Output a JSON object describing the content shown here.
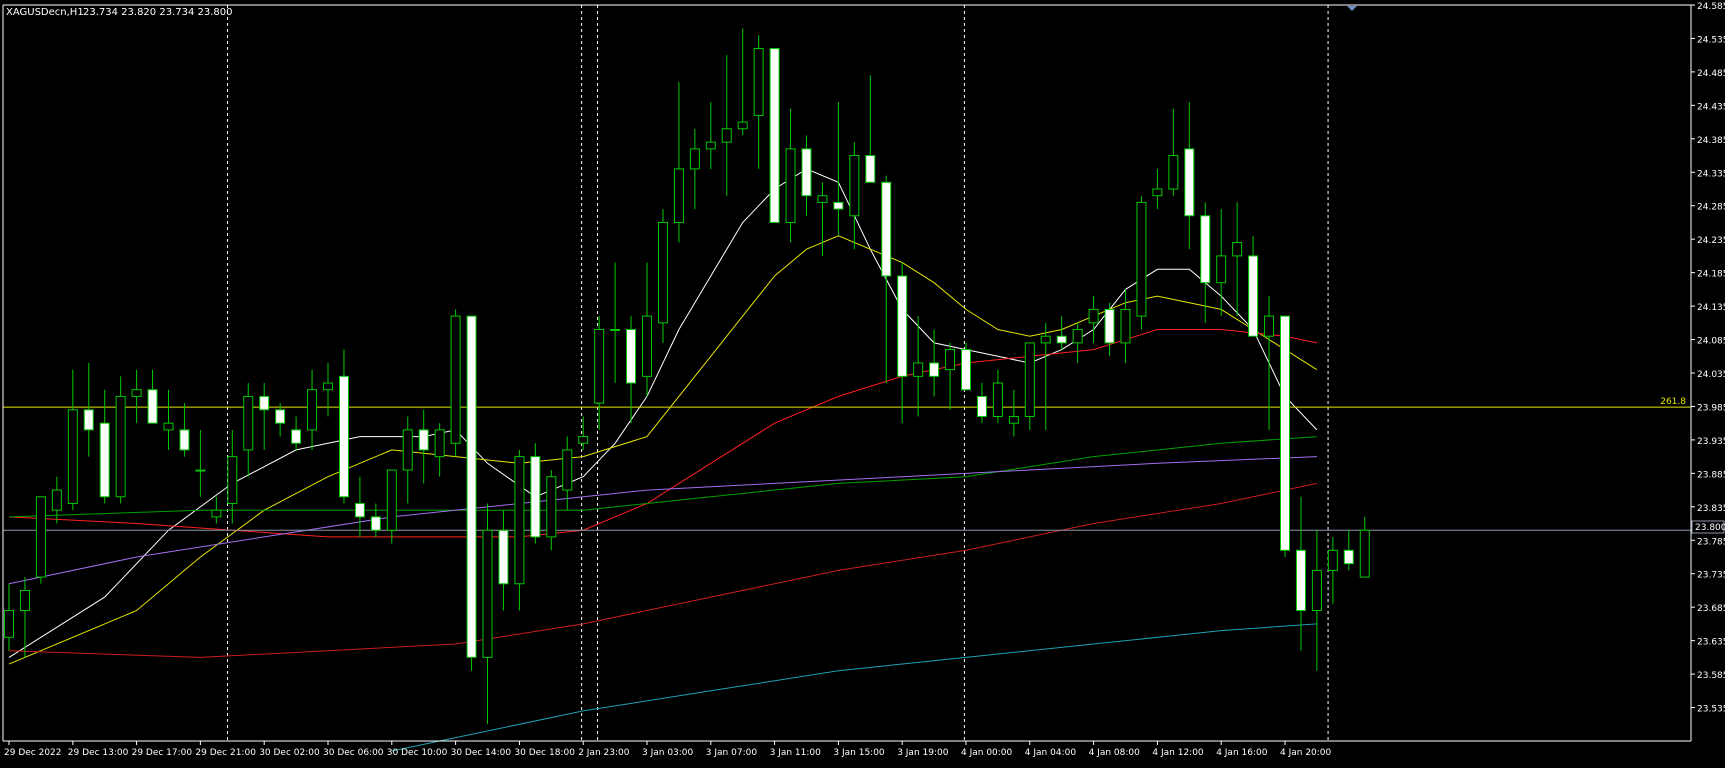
{
  "header": {
    "symbol_label": "XAGUSDecn,H1",
    "ohlc_label": "23.734 23.820 23.734 23.800"
  },
  "colors": {
    "background": "#000000",
    "frame": "#FFFFFF",
    "axis_text": "#FFFFFF",
    "candle_outline": "#00C800",
    "bull_fill": "#000000",
    "bear_fill": "#FFFFFF",
    "day_separator": "#FFFFFF",
    "fib_line": "#E6E600",
    "price_line": "#8C96A8",
    "price_label_bg": "#000000",
    "period_marker": "#6E8CBE"
  },
  "fib_level": {
    "label": "261.8",
    "price": 23.984
  },
  "current_price": {
    "label": "23.800",
    "price": 23.8
  },
  "chart_data": {
    "type": "candlestick",
    "timeframe": "H1",
    "symbol": "XAGUSDecn",
    "ylim": [
      23.485,
      24.585
    ],
    "y_ticks": [
      "23.535",
      "23.585",
      "23.635",
      "23.685",
      "23.735",
      "23.785",
      "23.835",
      "23.885",
      "23.935",
      "23.985",
      "24.035",
      "24.085",
      "24.135",
      "24.185",
      "24.235",
      "24.285",
      "24.335",
      "24.385",
      "24.435",
      "24.485",
      "24.535",
      "24.585"
    ],
    "x_labels": [
      {
        "label": "29 Dec 2022",
        "bar": 0
      },
      {
        "label": "29 Dec 13:00",
        "bar": 4
      },
      {
        "label": "29 Dec 17:00",
        "bar": 8
      },
      {
        "label": "29 Dec 21:00",
        "bar": 12
      },
      {
        "label": "30 Dec 02:00",
        "bar": 16
      },
      {
        "label": "30 Dec 06:00",
        "bar": 20
      },
      {
        "label": "30 Dec 10:00",
        "bar": 24
      },
      {
        "label": "30 Dec 14:00",
        "bar": 28
      },
      {
        "label": "30 Dec 18:00",
        "bar": 32
      },
      {
        "label": "2 Jan 23:00",
        "bar": 36
      },
      {
        "label": "3 Jan 03:00",
        "bar": 40
      },
      {
        "label": "3 Jan 07:00",
        "bar": 44
      },
      {
        "label": "3 Jan 11:00",
        "bar": 48
      },
      {
        "label": "3 Jan 15:00",
        "bar": 52
      },
      {
        "label": "3 Jan 19:00",
        "bar": 56
      },
      {
        "label": "4 Jan 00:00",
        "bar": 60
      },
      {
        "label": "4 Jan 04:00",
        "bar": 64
      },
      {
        "label": "4 Jan 08:00",
        "bar": 68
      },
      {
        "label": "4 Jan 12:00",
        "bar": 72
      },
      {
        "label": "4 Jan 16:00",
        "bar": 76
      },
      {
        "label": "4 Jan 20:00",
        "bar": 80
      }
    ],
    "separator_bars": [
      13.7,
      35.9,
      36.9,
      59.9,
      82.7
    ],
    "candles": [
      {
        "o": 23.64,
        "h": 23.72,
        "l": 23.62,
        "c": 23.68
      },
      {
        "o": 23.68,
        "h": 23.73,
        "l": 23.61,
        "c": 23.71
      },
      {
        "o": 23.73,
        "h": 23.85,
        "l": 23.72,
        "c": 23.85
      },
      {
        "o": 23.83,
        "h": 23.88,
        "l": 23.81,
        "c": 23.86
      },
      {
        "o": 23.84,
        "h": 24.04,
        "l": 23.83,
        "c": 23.98
      },
      {
        "o": 23.98,
        "h": 24.05,
        "l": 23.91,
        "c": 23.95
      },
      {
        "o": 23.96,
        "h": 24.01,
        "l": 23.84,
        "c": 23.85
      },
      {
        "o": 23.85,
        "h": 24.03,
        "l": 23.84,
        "c": 24.0
      },
      {
        "o": 24.0,
        "h": 24.04,
        "l": 23.96,
        "c": 24.01
      },
      {
        "o": 24.01,
        "h": 24.04,
        "l": 23.96,
        "c": 23.96
      },
      {
        "o": 23.95,
        "h": 24.01,
        "l": 23.92,
        "c": 23.96
      },
      {
        "o": 23.95,
        "h": 23.99,
        "l": 23.91,
        "c": 23.92
      },
      {
        "o": 23.89,
        "h": 23.95,
        "l": 23.85,
        "c": 23.89
      },
      {
        "o": 23.82,
        "h": 23.85,
        "l": 23.81,
        "c": 23.83
      },
      {
        "o": 23.84,
        "h": 23.95,
        "l": 23.81,
        "c": 23.91
      },
      {
        "o": 23.92,
        "h": 24.02,
        "l": 23.88,
        "c": 24.0
      },
      {
        "o": 24.0,
        "h": 24.02,
        "l": 23.92,
        "c": 23.98
      },
      {
        "o": 23.98,
        "h": 23.99,
        "l": 23.94,
        "c": 23.96
      },
      {
        "o": 23.95,
        "h": 23.97,
        "l": 23.92,
        "c": 23.93
      },
      {
        "o": 23.95,
        "h": 24.04,
        "l": 23.92,
        "c": 24.01
      },
      {
        "o": 24.01,
        "h": 24.05,
        "l": 23.97,
        "c": 24.02
      },
      {
        "o": 24.03,
        "h": 24.07,
        "l": 23.84,
        "c": 23.85
      },
      {
        "o": 23.84,
        "h": 23.88,
        "l": 23.79,
        "c": 23.82
      },
      {
        "o": 23.82,
        "h": 23.84,
        "l": 23.79,
        "c": 23.8
      },
      {
        "o": 23.8,
        "h": 23.89,
        "l": 23.78,
        "c": 23.89
      },
      {
        "o": 23.89,
        "h": 23.97,
        "l": 23.84,
        "c": 23.95
      },
      {
        "o": 23.95,
        "h": 23.98,
        "l": 23.87,
        "c": 23.92
      },
      {
        "o": 23.91,
        "h": 23.96,
        "l": 23.88,
        "c": 23.95
      },
      {
        "o": 23.93,
        "h": 24.13,
        "l": 23.91,
        "c": 24.12
      },
      {
        "o": 24.12,
        "h": 24.12,
        "l": 23.59,
        "c": 23.61
      },
      {
        "o": 23.61,
        "h": 23.84,
        "l": 23.51,
        "c": 23.8
      },
      {
        "o": 23.8,
        "h": 23.83,
        "l": 23.68,
        "c": 23.72
      },
      {
        "o": 23.72,
        "h": 23.92,
        "l": 23.68,
        "c": 23.91
      },
      {
        "o": 23.91,
        "h": 23.93,
        "l": 23.78,
        "c": 23.79
      },
      {
        "o": 23.79,
        "h": 23.89,
        "l": 23.77,
        "c": 23.88
      },
      {
        "o": 23.86,
        "h": 23.94,
        "l": 23.83,
        "c": 23.92
      },
      {
        "o": 23.93,
        "h": 23.97,
        "l": 23.92,
        "c": 23.94
      },
      {
        "o": 23.99,
        "h": 24.12,
        "l": 23.95,
        "c": 24.1
      },
      {
        "o": 24.1,
        "h": 24.2,
        "l": 24.02,
        "c": 24.1
      },
      {
        "o": 24.1,
        "h": 24.12,
        "l": 23.96,
        "c": 24.02
      },
      {
        "o": 24.03,
        "h": 24.2,
        "l": 24.0,
        "c": 24.12
      },
      {
        "o": 24.11,
        "h": 24.28,
        "l": 24.08,
        "c": 24.26
      },
      {
        "o": 24.26,
        "h": 24.47,
        "l": 24.23,
        "c": 24.34
      },
      {
        "o": 24.34,
        "h": 24.4,
        "l": 24.28,
        "c": 24.37
      },
      {
        "o": 24.37,
        "h": 24.44,
        "l": 24.34,
        "c": 24.38
      },
      {
        "o": 24.38,
        "h": 24.51,
        "l": 24.3,
        "c": 24.4
      },
      {
        "o": 24.4,
        "h": 24.55,
        "l": 24.39,
        "c": 24.41
      },
      {
        "o": 24.42,
        "h": 24.54,
        "l": 24.34,
        "c": 24.52
      },
      {
        "o": 24.52,
        "h": 24.52,
        "l": 24.26,
        "c": 24.26
      },
      {
        "o": 24.26,
        "h": 24.43,
        "l": 24.23,
        "c": 24.37
      },
      {
        "o": 24.37,
        "h": 24.39,
        "l": 24.27,
        "c": 24.3
      },
      {
        "o": 24.29,
        "h": 24.32,
        "l": 24.21,
        "c": 24.3
      },
      {
        "o": 24.29,
        "h": 24.44,
        "l": 24.24,
        "c": 24.28
      },
      {
        "o": 24.27,
        "h": 24.38,
        "l": 24.22,
        "c": 24.36
      },
      {
        "o": 24.36,
        "h": 24.48,
        "l": 24.32,
        "c": 24.32
      },
      {
        "o": 24.32,
        "h": 24.33,
        "l": 24.02,
        "c": 24.18
      },
      {
        "o": 24.18,
        "h": 24.2,
        "l": 23.96,
        "c": 24.03
      },
      {
        "o": 24.03,
        "h": 24.12,
        "l": 23.97,
        "c": 24.05
      },
      {
        "o": 24.05,
        "h": 24.1,
        "l": 24.0,
        "c": 24.03
      },
      {
        "o": 24.04,
        "h": 24.08,
        "l": 23.98,
        "c": 24.07
      },
      {
        "o": 24.07,
        "h": 24.08,
        "l": 24.01,
        "c": 24.01
      },
      {
        "o": 24.0,
        "h": 24.02,
        "l": 23.96,
        "c": 23.97
      },
      {
        "o": 23.97,
        "h": 24.04,
        "l": 23.96,
        "c": 24.02
      },
      {
        "o": 23.96,
        "h": 24.01,
        "l": 23.94,
        "c": 23.97
      },
      {
        "o": 23.97,
        "h": 24.08,
        "l": 23.95,
        "c": 24.08
      },
      {
        "o": 24.08,
        "h": 24.11,
        "l": 23.95,
        "c": 24.09
      },
      {
        "o": 24.09,
        "h": 24.12,
        "l": 24.07,
        "c": 24.08
      },
      {
        "o": 24.08,
        "h": 24.11,
        "l": 24.05,
        "c": 24.1
      },
      {
        "o": 24.11,
        "h": 24.15,
        "l": 24.08,
        "c": 24.13
      },
      {
        "o": 24.13,
        "h": 24.14,
        "l": 24.06,
        "c": 24.08
      },
      {
        "o": 24.08,
        "h": 24.16,
        "l": 24.05,
        "c": 24.13
      },
      {
        "o": 24.12,
        "h": 24.3,
        "l": 24.1,
        "c": 24.29
      },
      {
        "o": 24.3,
        "h": 24.34,
        "l": 24.28,
        "c": 24.31
      },
      {
        "o": 24.31,
        "h": 24.43,
        "l": 24.3,
        "c": 24.36
      },
      {
        "o": 24.37,
        "h": 24.44,
        "l": 24.22,
        "c": 24.27
      },
      {
        "o": 24.27,
        "h": 24.29,
        "l": 24.11,
        "c": 24.17
      },
      {
        "o": 24.17,
        "h": 24.28,
        "l": 24.12,
        "c": 24.21
      },
      {
        "o": 24.21,
        "h": 24.29,
        "l": 24.12,
        "c": 24.23
      },
      {
        "o": 24.21,
        "h": 24.24,
        "l": 24.11,
        "c": 24.09
      },
      {
        "o": 24.09,
        "h": 24.15,
        "l": 23.95,
        "c": 24.12
      },
      {
        "o": 24.12,
        "h": 24.12,
        "l": 23.76,
        "c": 23.77
      },
      {
        "o": 23.77,
        "h": 23.85,
        "l": 23.62,
        "c": 23.68
      },
      {
        "o": 23.68,
        "h": 23.8,
        "l": 23.59,
        "c": 23.74
      },
      {
        "o": 23.74,
        "h": 23.79,
        "l": 23.69,
        "c": 23.77
      },
      {
        "o": 23.77,
        "h": 23.8,
        "l": 23.74,
        "c": 23.75
      },
      {
        "o": 23.73,
        "h": 23.82,
        "l": 23.73,
        "c": 23.8
      }
    ],
    "moving_averages": [
      {
        "color": "#FFFFFF",
        "points": [
          [
            0,
            23.61
          ],
          [
            6,
            23.7
          ],
          [
            10,
            23.8
          ],
          [
            14,
            23.87
          ],
          [
            18,
            23.92
          ],
          [
            22,
            23.94
          ],
          [
            26,
            23.94
          ],
          [
            28,
            23.95
          ],
          [
            30,
            23.9
          ],
          [
            33,
            23.85
          ],
          [
            36,
            23.88
          ],
          [
            38,
            23.93
          ],
          [
            40,
            24.0
          ],
          [
            42,
            24.1
          ],
          [
            44,
            24.18
          ],
          [
            46,
            24.26
          ],
          [
            48,
            24.31
          ],
          [
            50,
            24.34
          ],
          [
            52,
            24.32
          ],
          [
            54,
            24.22
          ],
          [
            56,
            24.13
          ],
          [
            58,
            24.08
          ],
          [
            60,
            24.07
          ],
          [
            62,
            24.06
          ],
          [
            64,
            24.05
          ],
          [
            66,
            24.07
          ],
          [
            68,
            24.1
          ],
          [
            70,
            24.16
          ],
          [
            72,
            24.19
          ],
          [
            74,
            24.19
          ],
          [
            76,
            24.15
          ],
          [
            78,
            24.1
          ],
          [
            80,
            24.0
          ],
          [
            82,
            23.95
          ]
        ]
      },
      {
        "color": "#E6E600",
        "points": [
          [
            0,
            23.6
          ],
          [
            8,
            23.68
          ],
          [
            12,
            23.76
          ],
          [
            16,
            23.83
          ],
          [
            20,
            23.88
          ],
          [
            24,
            23.92
          ],
          [
            28,
            23.91
          ],
          [
            32,
            23.9
          ],
          [
            36,
            23.91
          ],
          [
            40,
            23.94
          ],
          [
            42,
            24.0
          ],
          [
            44,
            24.06
          ],
          [
            46,
            24.12
          ],
          [
            48,
            24.18
          ],
          [
            50,
            24.22
          ],
          [
            52,
            24.24
          ],
          [
            54,
            24.22
          ],
          [
            56,
            24.2
          ],
          [
            58,
            24.17
          ],
          [
            60,
            24.13
          ],
          [
            62,
            24.1
          ],
          [
            64,
            24.09
          ],
          [
            66,
            24.1
          ],
          [
            68,
            24.12
          ],
          [
            70,
            24.14
          ],
          [
            72,
            24.15
          ],
          [
            74,
            24.14
          ],
          [
            76,
            24.13
          ],
          [
            78,
            24.1
          ],
          [
            80,
            24.07
          ],
          [
            82,
            24.04
          ]
        ]
      },
      {
        "color": "#FF2020",
        "points": [
          [
            0,
            23.82
          ],
          [
            8,
            23.81
          ],
          [
            14,
            23.8
          ],
          [
            20,
            23.79
          ],
          [
            26,
            23.79
          ],
          [
            32,
            23.79
          ],
          [
            36,
            23.8
          ],
          [
            40,
            23.84
          ],
          [
            44,
            23.9
          ],
          [
            48,
            23.96
          ],
          [
            52,
            24.0
          ],
          [
            56,
            24.03
          ],
          [
            60,
            24.05
          ],
          [
            64,
            24.06
          ],
          [
            68,
            24.07
          ],
          [
            72,
            24.1
          ],
          [
            76,
            24.1
          ],
          [
            80,
            24.09
          ],
          [
            82,
            24.08
          ]
        ]
      },
      {
        "color": "#00A000",
        "points": [
          [
            0,
            23.82
          ],
          [
            12,
            23.83
          ],
          [
            24,
            23.83
          ],
          [
            36,
            23.83
          ],
          [
            44,
            23.85
          ],
          [
            52,
            23.87
          ],
          [
            60,
            23.88
          ],
          [
            68,
            23.91
          ],
          [
            76,
            23.93
          ],
          [
            82,
            23.94
          ]
        ]
      },
      {
        "color": "#A070F0",
        "points": [
          [
            0,
            23.72
          ],
          [
            8,
            23.76
          ],
          [
            16,
            23.79
          ],
          [
            24,
            23.82
          ],
          [
            32,
            23.84
          ],
          [
            40,
            23.86
          ],
          [
            48,
            23.87
          ],
          [
            56,
            23.88
          ],
          [
            64,
            23.89
          ],
          [
            72,
            23.9
          ],
          [
            82,
            23.91
          ]
        ]
      },
      {
        "color": "#C81E1E",
        "points": [
          [
            0,
            23.62
          ],
          [
            12,
            23.61
          ],
          [
            20,
            23.62
          ],
          [
            28,
            23.63
          ],
          [
            36,
            23.66
          ],
          [
            44,
            23.7
          ],
          [
            52,
            23.74
          ],
          [
            60,
            23.77
          ],
          [
            68,
            23.81
          ],
          [
            76,
            23.84
          ],
          [
            82,
            23.87
          ]
        ]
      },
      {
        "color": "#1EA0B4",
        "points": [
          [
            24,
            23.47
          ],
          [
            30,
            23.5
          ],
          [
            36,
            23.53
          ],
          [
            44,
            23.56
          ],
          [
            52,
            23.59
          ],
          [
            60,
            23.61
          ],
          [
            68,
            23.63
          ],
          [
            76,
            23.65
          ],
          [
            82,
            23.66
          ]
        ]
      }
    ]
  }
}
